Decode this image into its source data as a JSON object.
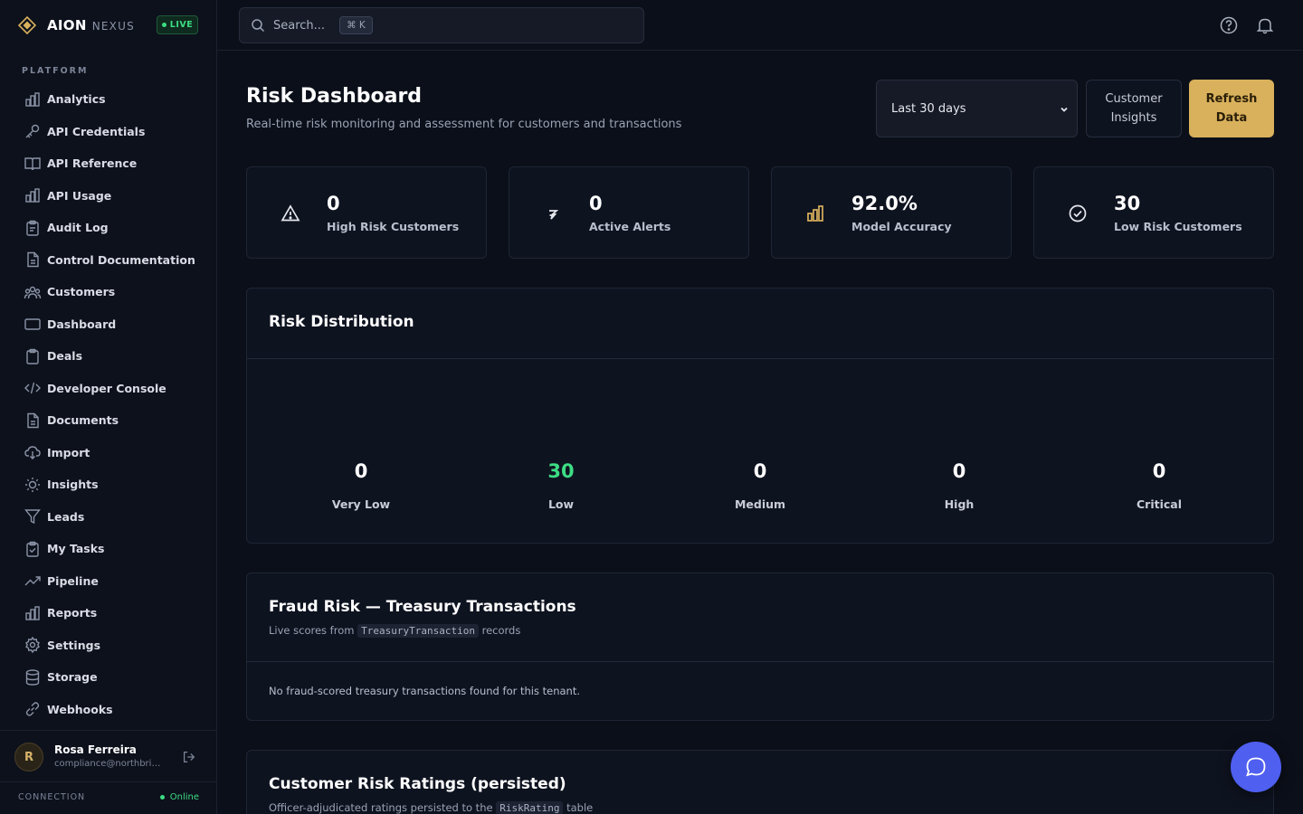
{
  "brand": {
    "name": "AION",
    "sub": "NEXUS",
    "badge": "LIVE"
  },
  "sidebar": {
    "section": "PLATFORM",
    "items": [
      {
        "label": "Analytics",
        "icon": "bar-chart-icon"
      },
      {
        "label": "API Credentials",
        "icon": "key-icon"
      },
      {
        "label": "API Reference",
        "icon": "book-icon"
      },
      {
        "label": "API Usage",
        "icon": "bar-chart-icon"
      },
      {
        "label": "Audit Log",
        "icon": "clipboard-icon"
      },
      {
        "label": "Control Documentation",
        "icon": "file-icon"
      },
      {
        "label": "Customers",
        "icon": "users-icon"
      },
      {
        "label": "Dashboard",
        "icon": "monitor-icon"
      },
      {
        "label": "Deals",
        "icon": "clipboard-icon"
      },
      {
        "label": "Developer Console",
        "icon": "code-icon"
      },
      {
        "label": "Documents",
        "icon": "file-icon"
      },
      {
        "label": "Import",
        "icon": "cloud-download-icon"
      },
      {
        "label": "Insights",
        "icon": "lightbulb-icon"
      },
      {
        "label": "Leads",
        "icon": "funnel-icon"
      },
      {
        "label": "My Tasks",
        "icon": "clipboard-check-icon"
      },
      {
        "label": "Pipeline",
        "icon": "trend-icon"
      },
      {
        "label": "Reports",
        "icon": "bar-chart-icon"
      },
      {
        "label": "Settings",
        "icon": "gear-icon"
      },
      {
        "label": "Storage",
        "icon": "database-icon"
      },
      {
        "label": "Webhooks",
        "icon": "link-icon"
      }
    ],
    "user": {
      "initial": "R",
      "name": "Rosa Ferreira",
      "email": "compliance@northbridg..."
    },
    "connection": {
      "label": "CONNECTION",
      "status": "Online"
    }
  },
  "topbar": {
    "search_placeholder": "Search...",
    "shortcut": "⌘ K"
  },
  "page": {
    "title": "Risk Dashboard",
    "subtitle": "Real-time risk monitoring and assessment for customers and transactions",
    "range": "Last 30 days",
    "customer_insights_line1": "Customer",
    "customer_insights_line2": "Insights",
    "refresh_line1": "Refresh",
    "refresh_line2": "Data"
  },
  "stats": [
    {
      "value": "0",
      "label": "High Risk Customers",
      "icon": "warning-icon"
    },
    {
      "value": "0",
      "label": "Active Alerts",
      "icon": "alert-flag-icon"
    },
    {
      "value": "92.0%",
      "label": "Model Accuracy",
      "icon": "bar-chart-icon"
    },
    {
      "value": "30",
      "label": "Low Risk Customers",
      "icon": "check-circle-icon"
    }
  ],
  "distribution": {
    "title": "Risk Distribution",
    "buckets": [
      {
        "label": "Very Low",
        "value": "0"
      },
      {
        "label": "Low",
        "value": "30",
        "color": "#3ddc84"
      },
      {
        "label": "Medium",
        "value": "0"
      },
      {
        "label": "High",
        "value": "0"
      },
      {
        "label": "Critical",
        "value": "0"
      }
    ]
  },
  "fraud": {
    "title": "Fraud Risk — Treasury Transactions",
    "sub_prefix": "Live scores from",
    "sub_code": "TreasuryTransaction",
    "sub_suffix": "records",
    "empty": "No fraud-scored treasury transactions found for this tenant."
  },
  "ratings": {
    "title": "Customer Risk Ratings (persisted)",
    "sub_prefix": "Officer-adjudicated ratings persisted to the",
    "sub_code": "RiskRating",
    "sub_suffix": "table"
  },
  "colors": {
    "accent": "#d9b15c",
    "success": "#3ddc84",
    "fab": "#4f5ff0"
  }
}
